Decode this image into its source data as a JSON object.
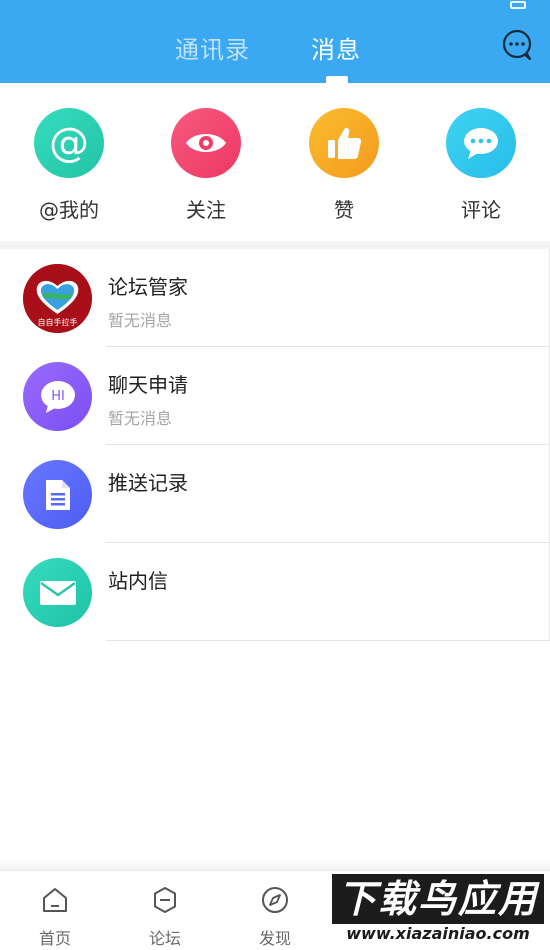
{
  "header": {
    "tabs": [
      {
        "label": "通讯录",
        "active": false
      },
      {
        "label": "消息",
        "active": true
      }
    ],
    "colors": {
      "bar": "#3aa9f1"
    }
  },
  "quick_actions": [
    {
      "label": "@我的",
      "icon": "at-icon",
      "color": "#2fd0b5",
      "glyph": "@"
    },
    {
      "label": "关注",
      "icon": "eye-icon",
      "color": "#f4486f"
    },
    {
      "label": "赞",
      "icon": "thumbs-up-icon",
      "color": "#f7a825"
    },
    {
      "label": "评论",
      "icon": "comment-icon",
      "color": "#33c8ee"
    }
  ],
  "messages": [
    {
      "title": "论坛管家",
      "subtitle": "暂无消息",
      "avatar": "forum-manager-avatar",
      "avatar_text": "自自手拉手"
    },
    {
      "title": "聊天申请",
      "subtitle": "暂无消息",
      "avatar": "chat-request-icon",
      "avatar_text": "HI"
    },
    {
      "title": "推送记录",
      "subtitle": "",
      "avatar": "document-icon"
    },
    {
      "title": "站内信",
      "subtitle": "",
      "avatar": "mail-icon"
    }
  ],
  "bottom_nav": [
    {
      "label": "首页",
      "icon": "home-icon"
    },
    {
      "label": "论坛",
      "icon": "forum-icon"
    },
    {
      "label": "发现",
      "icon": "compass-icon"
    }
  ],
  "watermark": {
    "title": "下载鸟应用",
    "url": "www.xiazainiao.com"
  }
}
